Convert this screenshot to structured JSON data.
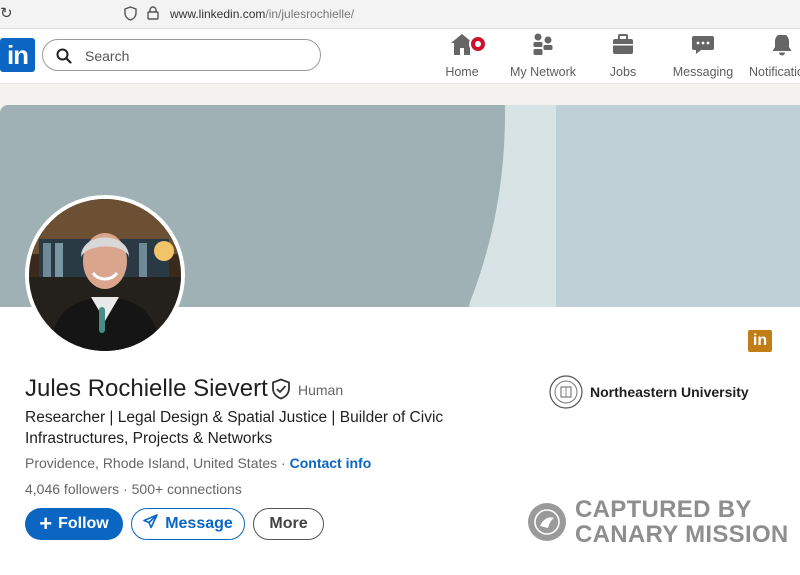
{
  "browser": {
    "url_prefix": "www.linkedin.com",
    "url_path": "/in/julesrochielle/"
  },
  "nav": {
    "logo": "in",
    "search_placeholder": "Search",
    "items": [
      {
        "label": "Home",
        "icon": "home-icon"
      },
      {
        "label": "My Network",
        "icon": "network-icon"
      },
      {
        "label": "Jobs",
        "icon": "briefcase-icon"
      },
      {
        "label": "Messaging",
        "icon": "chat-icon"
      },
      {
        "label": "Notifications",
        "icon": "bell-icon"
      }
    ]
  },
  "profile": {
    "name": "Jules Rochielle Sievert",
    "verification": "Human",
    "headline": "Researcher | Legal Design & Spatial Justice | Builder of Civic Infrastructures, Projects & Networks",
    "location": "Providence, Rhode Island, United States",
    "separator": " · ",
    "contact_label": "Contact info",
    "followers": "4,046 followers",
    "connections": "500+ connections",
    "stats_separator": " · ",
    "education": "Northeastern University",
    "badge_logo": "in"
  },
  "actions": {
    "follow": "Follow",
    "message": "Message",
    "more": "More"
  },
  "watermark": {
    "line1": "CAPTURED BY",
    "line2": "CANARY MISSION"
  },
  "colors": {
    "brand": "#0a66c2",
    "notification": "#cb112d",
    "banner": "#bfd1d6",
    "watermark": "#8e8e8e"
  }
}
